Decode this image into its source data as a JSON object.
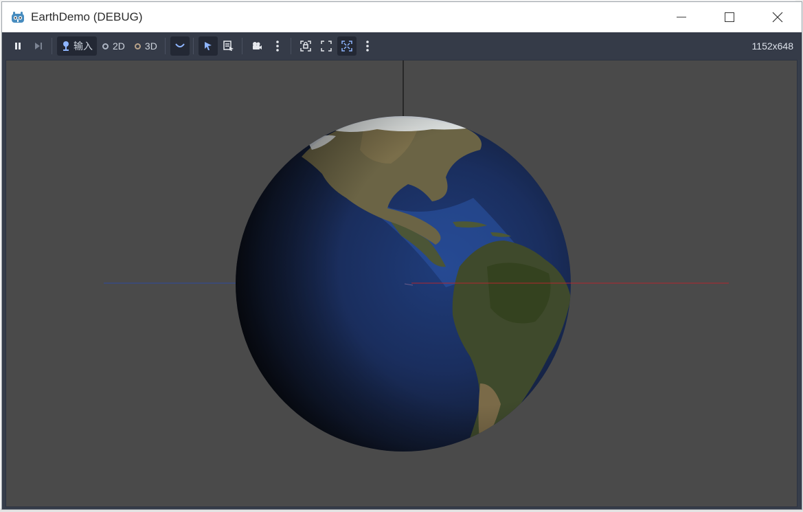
{
  "window": {
    "title": "EarthDemo (DEBUG)",
    "app_icon": "godot-icon",
    "controls": [
      "minimize-icon",
      "maximize-icon",
      "close-icon"
    ]
  },
  "toolbar": {
    "pause_icon": "pause-icon",
    "next_frame_icon": "next-frame-icon",
    "input_label": "输入",
    "mode_2d_label": "2D",
    "mode_3d_label": "3D",
    "resolution": "1152x648"
  },
  "viewport": {
    "background": "#4a4a4a",
    "axis_colors": {
      "x": "#b3262e",
      "y": "#111111",
      "z": "#2d4a9e"
    }
  },
  "colors": {
    "accent": "#8fb6ff",
    "toolbar": "#353b48",
    "active_button": "#232834"
  }
}
